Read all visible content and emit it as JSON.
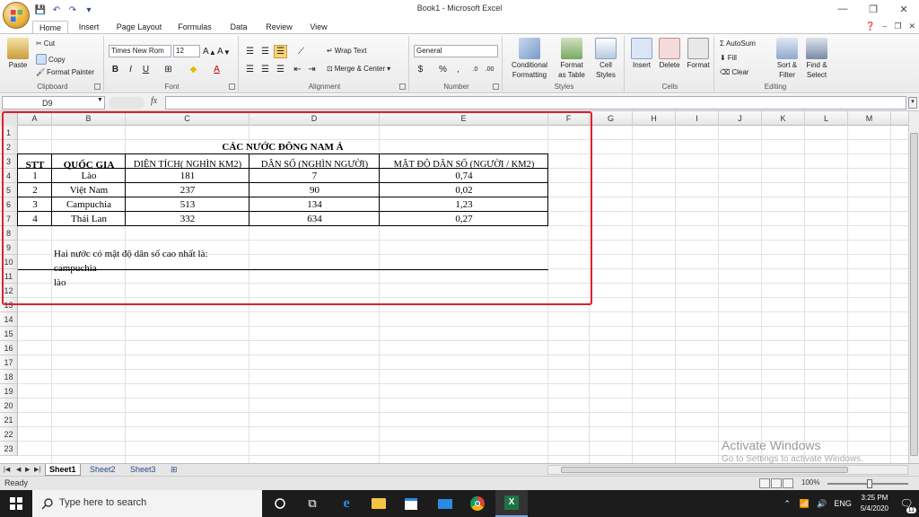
{
  "window": {
    "title": "Book1 - Microsoft Excel"
  },
  "ribbon": {
    "tabs": [
      "Home",
      "Insert",
      "Page Layout",
      "Formulas",
      "Data",
      "Review",
      "View"
    ],
    "clipboard": {
      "paste": "Paste",
      "cut": "Cut",
      "copy": "Copy",
      "format_painter": "Format Painter",
      "label": "Clipboard"
    },
    "font": {
      "font_name": "Times New Rom",
      "font_size": "12",
      "bold": "B",
      "italic": "I",
      "underline": "U",
      "label": "Font"
    },
    "alignment": {
      "wrap_text": "Wrap Text",
      "merge_center": "Merge & Center",
      "label": "Alignment"
    },
    "number": {
      "format": "General",
      "currency": "$",
      "percent": "%",
      "comma": ",",
      "label": "Number"
    },
    "styles": {
      "conditional_line1": "Conditional",
      "conditional_line2": "Formatting",
      "format_table_line1": "Format",
      "format_table_line2": "as Table",
      "cell_styles_line1": "Cell",
      "cell_styles_line2": "Styles",
      "label": "Styles"
    },
    "cells": {
      "insert": "Insert",
      "delete": "Delete",
      "format": "Format",
      "label": "Cells"
    },
    "editing": {
      "autosum": "AutoSum",
      "fill": "Fill",
      "clear": "Clear",
      "sort_line1": "Sort &",
      "sort_line2": "Filter",
      "find_line1": "Find &",
      "find_line2": "Select",
      "label": "Editing"
    }
  },
  "formula_bar": {
    "name_box": "D9",
    "fx": "fx",
    "formula": ""
  },
  "sheet": {
    "columns": [
      "A",
      "B",
      "C",
      "D",
      "E",
      "F",
      "G",
      "H",
      "I",
      "J",
      "K",
      "L",
      "M"
    ],
    "rows": [
      "1",
      "2",
      "3",
      "4",
      "5",
      "6",
      "7",
      "8",
      "9",
      "10",
      "11",
      "12",
      "13",
      "14",
      "15",
      "16",
      "17",
      "18",
      "19",
      "20",
      "21",
      "22",
      "23"
    ],
    "table_title": "CÁC NƯỚC ĐÔNG NAM Á",
    "headers": [
      "STT",
      "QUỐC GIA",
      "DIỆN TÍCH( NGHÌN KM2)",
      "DÂN SỐ (NGHÌN NGƯỜI)",
      "MẬT ĐỘ DÂN SỐ (NGƯỜI / KM2)"
    ],
    "table_rows": [
      [
        "1",
        "Lào",
        "181",
        "7",
        "0,74"
      ],
      [
        "2",
        "Việt Nam",
        "237",
        "90",
        "0,02"
      ],
      [
        "3",
        "Campuchia",
        "513",
        "134",
        "1,23"
      ],
      [
        "4",
        "Thái Lan",
        "332",
        "634",
        "0,27"
      ]
    ],
    "note": "Hai nước có mật độ dân số cao nhất là:",
    "answer_1": "campuchia",
    "answer_2": "lào"
  },
  "sheet_tabs": [
    "Sheet1",
    "Sheet2",
    "Sheet3"
  ],
  "status": {
    "ready": "Ready",
    "zoom": "100%"
  },
  "watermark": {
    "line1": "Activate Windows",
    "line2": "Go to Settings to activate Windows."
  },
  "taskbar": {
    "search_placeholder": "Type here to search",
    "language": "ENG",
    "time": "3:25 PM",
    "date": "5/4/2020",
    "notifications": "11"
  },
  "colors": {
    "highlight_border": "#e0202a",
    "excel_green": "#1f7244",
    "taskbar_bg": "#1c1c1c"
  }
}
